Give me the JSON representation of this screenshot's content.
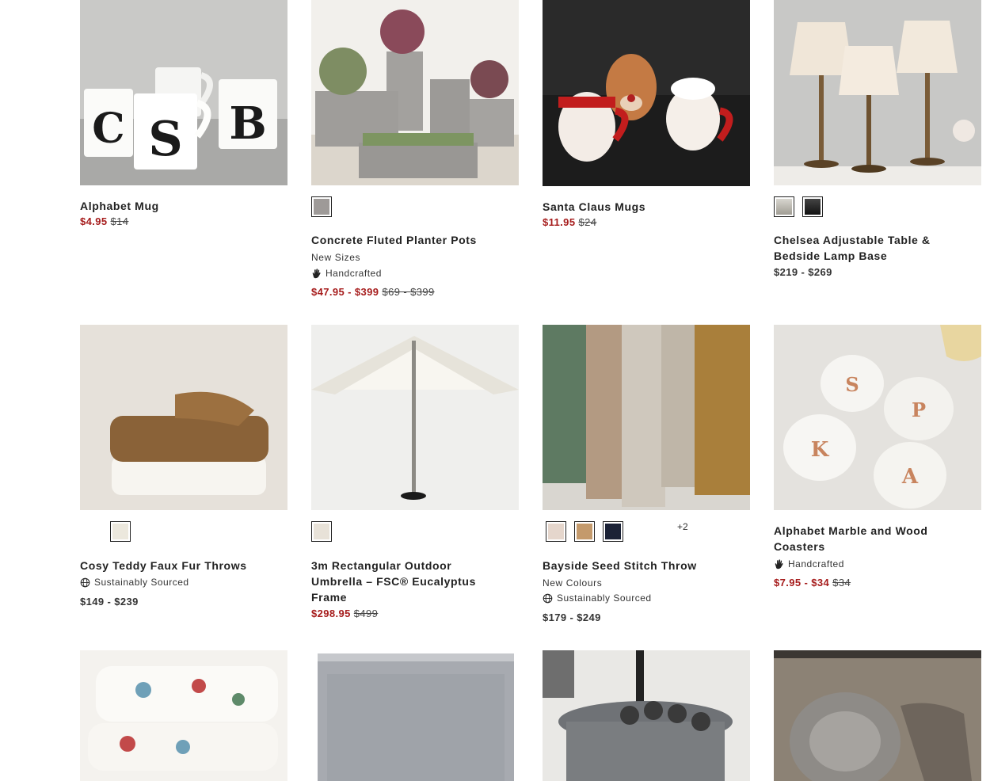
{
  "products": [
    {
      "title": "Alphabet Mug",
      "sale_price": "$4.95",
      "was_price": "$14"
    },
    {
      "title": "Concrete Fluted Planter Pots",
      "subtitle": "New Sizes",
      "badge": "Handcrafted",
      "sale_price": "$47.95 - $399",
      "was_price": "$69 - $399",
      "swatches": [
        "#9e9a98"
      ]
    },
    {
      "title": "Santa Claus Mugs",
      "sale_price": "$11.95",
      "was_price": "$24"
    },
    {
      "title": "Chelsea Adjustable Table & Bedside Lamp Base",
      "price": "$219 - $269",
      "swatches": [
        "#b9b6ae",
        "#1d1d1d"
      ]
    },
    {
      "title": "Cosy Teddy Faux Fur Throws",
      "badge": "Sustainably Sourced",
      "price": "$149 - $239",
      "swatches": [
        "#ece8dd"
      ]
    },
    {
      "title": "3m Rectangular Outdoor Umbrella – FSC® Eucalyptus Frame",
      "sale_price": "$298.95",
      "was_price": "$499",
      "swatches": [
        "#e8e2d8"
      ]
    },
    {
      "title": "Bayside Seed Stitch Throw",
      "subtitle": "New Colours",
      "badge": "Sustainably Sourced",
      "price": "$179 - $249",
      "swatches": [
        "#e5d6cc",
        "#c49a6c",
        "#1b2236"
      ],
      "more": "+2"
    },
    {
      "title": "Alphabet Marble and Wood Coasters",
      "badge": "Handcrafted",
      "sale_price": "$7.95 - $34",
      "was_price": "$34"
    }
  ],
  "images": {
    "mug_letters": [
      "C",
      "S",
      "B"
    ],
    "coaster_letters": [
      "S",
      "P",
      "K",
      "A"
    ]
  }
}
